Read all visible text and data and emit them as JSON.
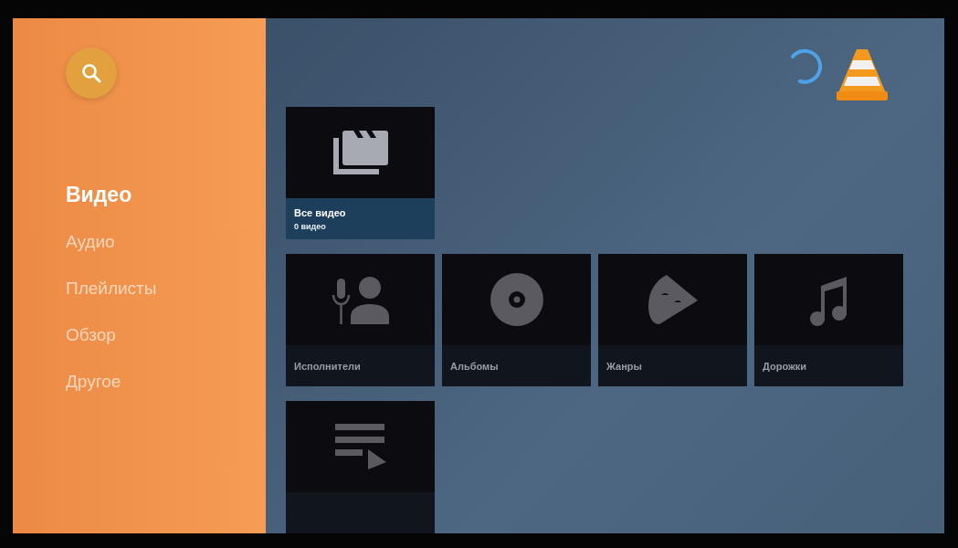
{
  "sidebar": {
    "items": [
      {
        "label": "Видео",
        "selected": true
      },
      {
        "label": "Аудио",
        "selected": false
      },
      {
        "label": "Плейлисты",
        "selected": false
      },
      {
        "label": "Обзор",
        "selected": false
      },
      {
        "label": "Другое",
        "selected": false
      }
    ]
  },
  "rows": [
    {
      "cards": [
        {
          "kind": "video",
          "title": "Все видео",
          "subtitle": "0 видео",
          "focused": true
        }
      ]
    },
    {
      "cards": [
        {
          "kind": "artists",
          "title": "Исполнители",
          "focused": false
        },
        {
          "kind": "albums",
          "title": "Альбомы",
          "focused": false
        },
        {
          "kind": "genres",
          "title": "Жанры",
          "focused": false
        },
        {
          "kind": "tracks",
          "title": "Дорожки",
          "focused": false
        }
      ]
    },
    {
      "cards": [
        {
          "kind": "playlists",
          "focused": false
        }
      ]
    }
  ]
}
